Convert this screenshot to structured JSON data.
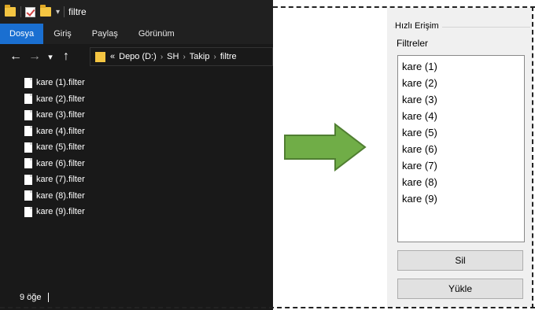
{
  "explorer": {
    "title": "filtre",
    "ribbon_tabs": [
      {
        "label": "Dosya"
      },
      {
        "label": "Giriş"
      },
      {
        "label": "Paylaş"
      },
      {
        "label": "Görünüm"
      }
    ],
    "breadcrumb": {
      "overflow": "«",
      "items": [
        "Depo (D:)",
        "SH",
        "Takip",
        "filtre"
      ],
      "separator": "›"
    },
    "files": [
      {
        "name": "kare (1).filter"
      },
      {
        "name": "kare (2).filter"
      },
      {
        "name": "kare (3).filter"
      },
      {
        "name": "kare (4).filter"
      },
      {
        "name": "kare (5).filter"
      },
      {
        "name": "kare (6).filter"
      },
      {
        "name": "kare (7).filter"
      },
      {
        "name": "kare (8).filter"
      },
      {
        "name": "kare (9).filter"
      }
    ],
    "status": "9 öğe"
  },
  "panel": {
    "group_title": "Hızlı Erişim",
    "list_label": "Filtreler",
    "items": [
      "kare (1)",
      "kare (2)",
      "kare (3)",
      "kare (4)",
      "kare (5)",
      "kare (6)",
      "kare (7)",
      "kare (8)",
      "kare (9)"
    ],
    "delete_button": "Sil",
    "load_button": "Yükle"
  },
  "colors": {
    "explorer_bg": "#191919",
    "active_tab": "#1a6fd1",
    "arrow_fill": "#70ad47",
    "arrow_stroke": "#507e32",
    "panel_bg": "#f0f0f0"
  }
}
